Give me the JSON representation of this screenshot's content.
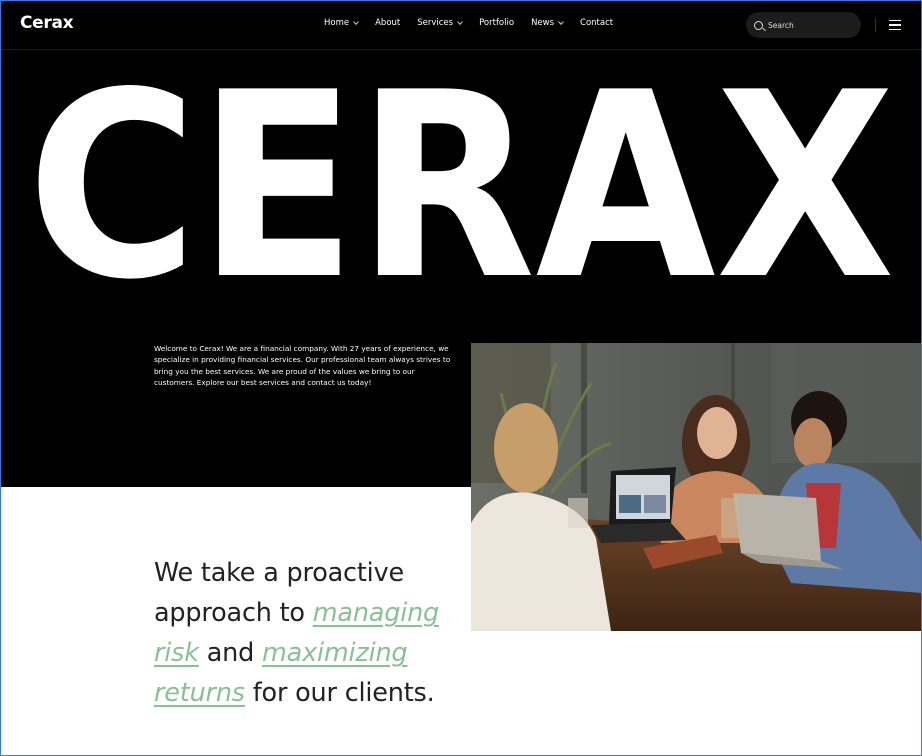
{
  "brand": {
    "logo": "Cerax",
    "hero_word": "CERAX"
  },
  "nav": {
    "items": [
      {
        "label": "Home",
        "has_dropdown": true
      },
      {
        "label": "About",
        "has_dropdown": false
      },
      {
        "label": "Services",
        "has_dropdown": true
      },
      {
        "label": "Portfolio",
        "has_dropdown": false
      },
      {
        "label": "News",
        "has_dropdown": true
      },
      {
        "label": "Contact",
        "has_dropdown": false
      }
    ]
  },
  "search": {
    "placeholder": "Search",
    "icon": "search-icon"
  },
  "menu": {
    "icon": "hamburger-menu-icon"
  },
  "intro": {
    "text": "Welcome to Cerax! We are a financial company. With 27 years of experience, we specialize in providing financial services. Our professional team always strives to bring you the best services. We are proud of the values we bring to our customers. Explore our best services and contact us today!"
  },
  "tagline": {
    "part1": "We take a proactive approach to",
    "highlight1": "managing risk",
    "part2": "and",
    "highlight2": "maximizing returns",
    "part3": "for our clients."
  },
  "colors": {
    "background_dark": "#000000",
    "accent": "#8bbf95",
    "text_dark": "#222222"
  }
}
